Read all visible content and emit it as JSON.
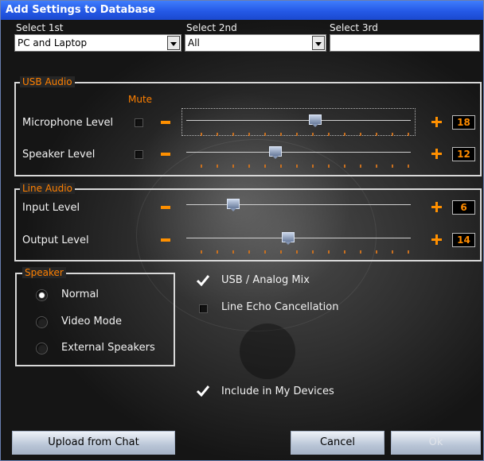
{
  "window": {
    "title": "Add Settings to Database"
  },
  "selects": [
    {
      "label": "Select 1st",
      "value": "PC and Laptop"
    },
    {
      "label": "Select 2nd",
      "value": "All"
    },
    {
      "label": "Select 3rd",
      "value": ""
    }
  ],
  "usb_audio": {
    "title": "USB Audio",
    "mute_label": "Mute",
    "rows": [
      {
        "label": "Microphone Level",
        "value": "18",
        "level": 0.58
      },
      {
        "label": "Speaker Level",
        "value": "12",
        "level": 0.39
      }
    ]
  },
  "line_audio": {
    "title": "Line Audio",
    "rows": [
      {
        "label": "Input Level",
        "value": "6",
        "level": 0.19
      },
      {
        "label": "Output Level",
        "value": "14",
        "level": 0.45
      }
    ]
  },
  "speaker": {
    "title": "Speaker",
    "options": [
      {
        "label": "Normal",
        "selected": true
      },
      {
        "label": "Video Mode",
        "selected": false
      },
      {
        "label": "External Speakers",
        "selected": false
      }
    ]
  },
  "options": {
    "usb_analog_mix": {
      "label": "USB / Analog Mix",
      "checked": true
    },
    "line_echo_cancellation": {
      "label": "Line Echo Cancellation",
      "checked": false
    },
    "include_in_my_devices": {
      "label": "Include in My Devices",
      "checked": true
    }
  },
  "buttons": {
    "upload": "Upload from Chat",
    "cancel": "Cancel",
    "ok": "Ok"
  },
  "colors": {
    "accent": "#ff8000",
    "titlebar": "#2459e6"
  }
}
